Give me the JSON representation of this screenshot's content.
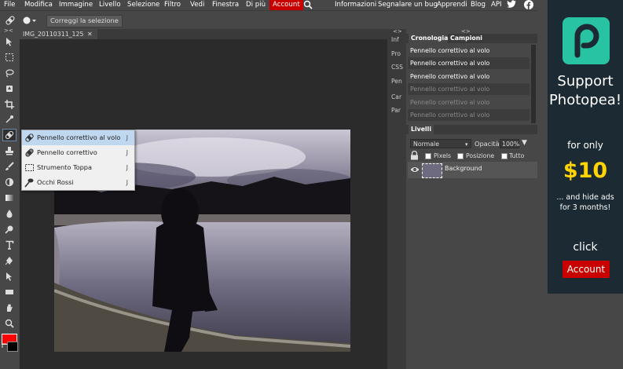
{
  "menubar": {
    "items": [
      "File",
      "Modifica",
      "Immagine",
      "Livello",
      "Selezione",
      "Filtro",
      "Vedi",
      "Finestra",
      "Di più",
      "Account"
    ],
    "right_links": [
      "Informazioni",
      "Segnalare un bug",
      "Apprendi",
      "Blog",
      "API"
    ]
  },
  "optionsbar": {
    "button_label": "Correggi la selezione"
  },
  "document": {
    "tab_title": "IMG_20110311_125",
    "close_glyph": "✕"
  },
  "flyout": {
    "items": [
      {
        "label": "Pennello correttivo al volo",
        "key": "J",
        "icon": "spot-healing-icon"
      },
      {
        "label": "Pennello correttivo",
        "key": "J",
        "icon": "healing-brush-icon"
      },
      {
        "label": "Strumento Toppa",
        "key": "J",
        "icon": "patch-icon"
      },
      {
        "label": "Occhi Rossi",
        "key": "J",
        "icon": "red-eye-icon"
      }
    ]
  },
  "side_tabs": [
    "Inf",
    "Pro",
    "CSS",
    "Pen",
    "Car",
    "Par"
  ],
  "history_panel": {
    "tabs": [
      "Cronologia",
      "Campioni"
    ],
    "rows": [
      "Pennello correttivo al volo",
      "Pennello correttivo al volo",
      "Pennello correttivo al volo",
      "Pennello correttivo al volo",
      "Pennello correttivo al volo",
      "Pennello correttivo al volo"
    ]
  },
  "layers_panel": {
    "tab": "Livelli",
    "blend_mode": "Normale",
    "opacity_label": "Opacità:",
    "opacity_value": "100%",
    "lock_options": [
      "Pixels",
      "Posizione",
      "Tutto"
    ],
    "layer_name": "Background"
  },
  "ad": {
    "line1": "Support",
    "line2": "Photopea!",
    "line3": "for only",
    "price": "$10",
    "line4": "... and hide ads",
    "line5": "for 3 months!",
    "cta_text": "click",
    "button": "Account"
  },
  "colors": {
    "accent_red": "#c80000",
    "foreground": "#ff0000",
    "background": "#000000",
    "ad_teal": "#28c3a3",
    "ad_price": "#ffd400"
  },
  "panel_glyphs": {
    "collapse": "<>",
    "expand": "><"
  }
}
